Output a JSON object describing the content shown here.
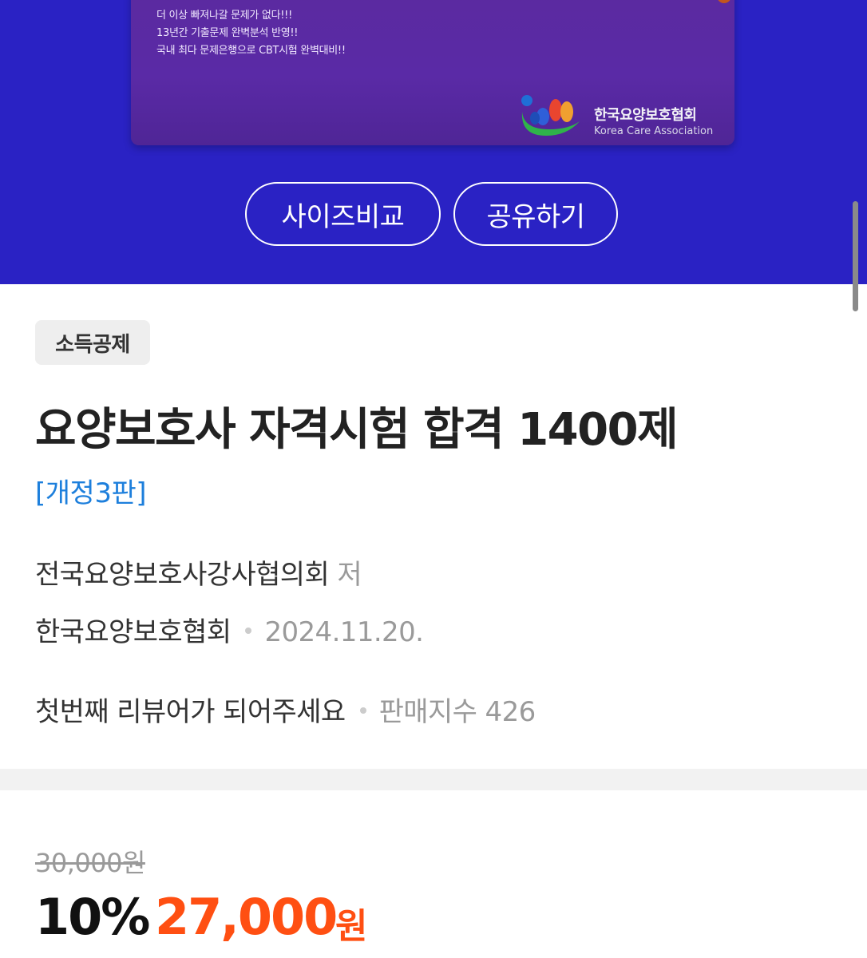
{
  "cover": {
    "lines": [
      "더 이상 빠져나갈 문제가 없다!!!",
      "13년간 기출문제 완벽분석 반영!!",
      "국내 최다 문제은행으로 CBT시험 완벽대비!!"
    ],
    "association_name": "한국요양보호협회",
    "association_english": "Korea Care Association"
  },
  "actions": {
    "size_compare_label": "사이즈비교",
    "share_label": "공유하기"
  },
  "badge": "소득공제",
  "book": {
    "title": "요양보호사 자격시험 합격 1400제",
    "edition": "[개정3판]",
    "author": "전국요양보호사강사협의회",
    "author_suffix": "저",
    "publisher": "한국요양보호협회",
    "date": "2024.11.20."
  },
  "stats": {
    "review_text": "첫번째 리뷰어가 되어주세요",
    "sales_index_label": "판매지수",
    "sales_index_value": "426"
  },
  "price": {
    "original": "30,000원",
    "discount": "10%",
    "sale": "27,000",
    "currency": "원"
  },
  "colors": {
    "hero_bg": "#2a22c4",
    "cover": "#5b2aa0",
    "edition_blue": "#1d7fdc",
    "sale_orange": "#ff4f12"
  },
  "icons": [
    "association-logo-icon"
  ]
}
